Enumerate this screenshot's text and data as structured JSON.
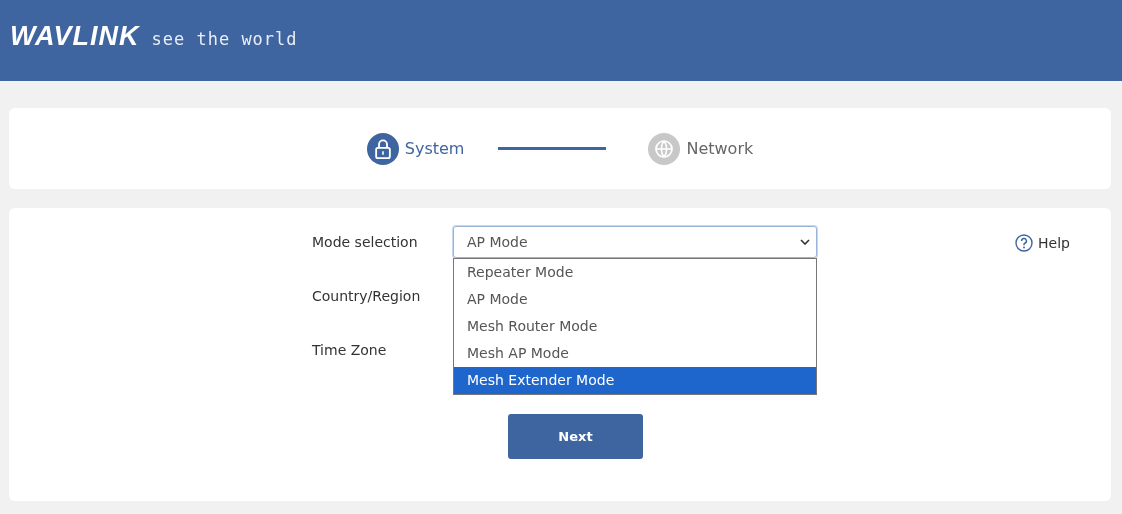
{
  "header": {
    "logo": "WAVLINK",
    "tagline": "see the world"
  },
  "steps": [
    {
      "label": "System",
      "kind": "lock",
      "active": true
    },
    {
      "label": "Network",
      "kind": "globe",
      "active": false
    }
  ],
  "form": {
    "fields": [
      {
        "label": "Mode selection",
        "value": "AP Mode",
        "open": true,
        "options": [
          {
            "label": "Repeater Mode",
            "highlighted": false
          },
          {
            "label": "AP Mode",
            "highlighted": false
          },
          {
            "label": "Mesh Router Mode",
            "highlighted": false
          },
          {
            "label": "Mesh AP Mode",
            "highlighted": false
          },
          {
            "label": "Mesh Extender Mode",
            "highlighted": true
          }
        ]
      },
      {
        "label": "Country/Region"
      },
      {
        "label": "Time Zone"
      }
    ],
    "help": "Help",
    "button": "Next"
  }
}
